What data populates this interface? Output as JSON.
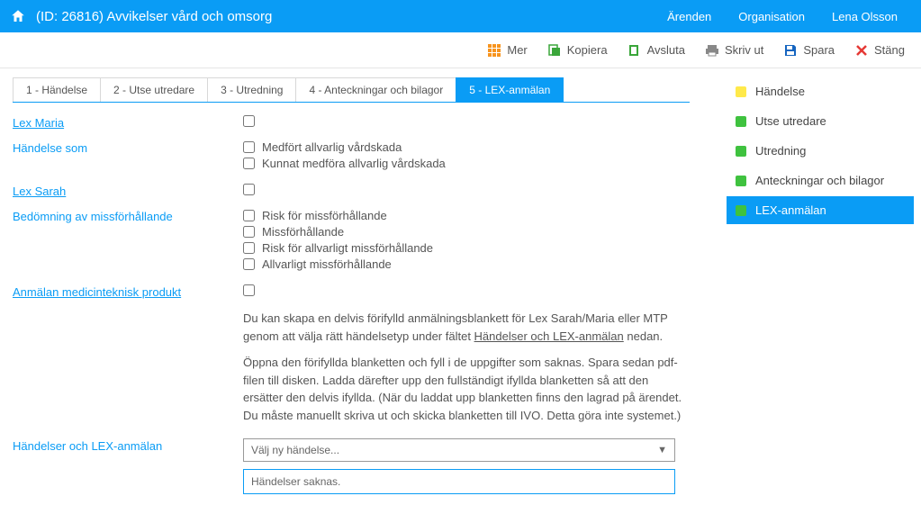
{
  "header": {
    "title": "(ID: 26816) Avvikelser vård och omsorg",
    "nav": [
      "Ärenden",
      "Organisation",
      "Lena Olsson"
    ]
  },
  "toolbar": {
    "more": "Mer",
    "copy": "Kopiera",
    "close_case": "Avsluta",
    "print": "Skriv ut",
    "save": "Spara",
    "close": "Stäng"
  },
  "tabs": [
    {
      "label": "1 - Händelse"
    },
    {
      "label": "2 - Utse utredare"
    },
    {
      "label": "3 - Utredning"
    },
    {
      "label": "4 - Anteckningar och bilagor"
    },
    {
      "label": "5 - LEX-anmälan",
      "active": true
    }
  ],
  "fields": {
    "lex_maria": {
      "label": "Lex Maria"
    },
    "handelse_som": {
      "label": "Händelse som",
      "options": [
        "Medfört allvarlig vårdskada",
        "Kunnat medföra allvarlig vårdskada"
      ]
    },
    "lex_sarah": {
      "label": "Lex Sarah"
    },
    "bedomning": {
      "label": "Bedömning av missförhållande",
      "options": [
        "Risk för missförhållande",
        "Missförhållande",
        "Risk för allvarligt missförhållande",
        "Allvarligt missförhållande"
      ]
    },
    "medicin": {
      "label": "Anmälan medicinteknisk produkt"
    },
    "info": {
      "p1_a": "Du kan skapa en delvis förifylld anmälningsblankett för Lex Sarah/Maria eller MTP genom att välja rätt händelsetyp under fältet ",
      "p1_u": "Händelser och LEX-anmälan",
      "p1_b": " nedan.",
      "p2": "Öppna den förifyllda blanketten och fyll i de uppgifter som saknas. Spara sedan pdf-filen till disken. Ladda därefter upp den fullständigt ifyllda blanketten så att den ersätter den delvis ifyllda. (När du laddat upp blanketten finns den lagrad på ärendet. Du måste manuellt skriva ut och skicka blanketten till IVO. Detta göra inte systemet.)"
    },
    "handelser_lex": {
      "label": "Händelser och LEX-anmälan",
      "placeholder": "Välj ny händelse...",
      "message": "Händelser saknas."
    }
  },
  "side": [
    {
      "label": "Händelse",
      "status": "yellow"
    },
    {
      "label": "Utse utredare",
      "status": "green"
    },
    {
      "label": "Utredning",
      "status": "green"
    },
    {
      "label": "Anteckningar och bilagor",
      "status": "green"
    },
    {
      "label": "LEX-anmälan",
      "status": "green",
      "active": true
    }
  ]
}
